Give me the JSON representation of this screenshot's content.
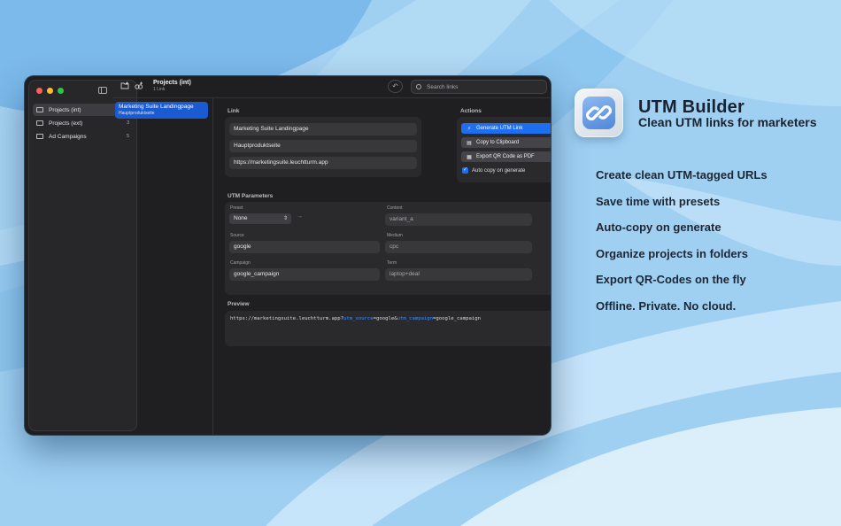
{
  "colors": {
    "accent": "#1d6ff0",
    "selection": "#1a5bd1",
    "window_bg": "#1f1f21",
    "page_bg": "#9fd0f2"
  },
  "sidebar": {
    "folders": [
      {
        "name": "Projects (int)",
        "count": "1",
        "active": true
      },
      {
        "name": "Projects (ext)",
        "count": "3",
        "active": false
      },
      {
        "name": "Ad Campaigns",
        "count": "5",
        "active": false
      }
    ]
  },
  "toolbar": {
    "project_title": "Projects (int)",
    "project_sub": "1 Link",
    "search_placeholder": "Search links",
    "icons": [
      "new-folder-icon",
      "new-link-icon",
      "undo-icon",
      "search-icon"
    ]
  },
  "links": [
    {
      "title": "Marketing Suite Landingpage",
      "subtitle": "Hauptproduktseite"
    }
  ],
  "link_section": {
    "title": "Link",
    "name": "Marketing Suite Landingpage",
    "description": "Hauptproduktseite",
    "url": "https://marketingsuite.leuchtturm.app"
  },
  "actions": {
    "title": "Actions",
    "generate": "Generate UTM Link",
    "copy": "Copy to Clipboard",
    "export": "Export QR Code as PDF",
    "auto_copy": "Auto copy on generate",
    "auto_copy_checked": true
  },
  "utm": {
    "title": "UTM Parameters",
    "preset_label": "Preset",
    "preset_value": "None",
    "content_label": "Content",
    "content_value": "variant_a",
    "source_label": "Source",
    "source_value": "google",
    "medium_label": "Medium",
    "medium_value": "cpc",
    "campaign_label": "Campaign",
    "campaign_value": "google_campaign",
    "term_label": "Term",
    "term_value": "laptop+deal"
  },
  "preview": {
    "title": "Preview",
    "base": "https://marketingsuite.leuchtturm.app?",
    "k1": "utm_source",
    "v1": "=google&",
    "k2": "utm_campaign",
    "v2": "=google_campaign"
  },
  "brand": {
    "title": "UTM Builder",
    "subtitle": "Clean UTM links for marketers",
    "app_icon": "link-chain-icon"
  },
  "features": [
    "Create clean UTM-tagged URLs",
    "Save time with presets",
    "Auto-copy on generate",
    "Organize projects in folders",
    "Export QR-Codes on the fly",
    "Offline. Private. No cloud."
  ]
}
